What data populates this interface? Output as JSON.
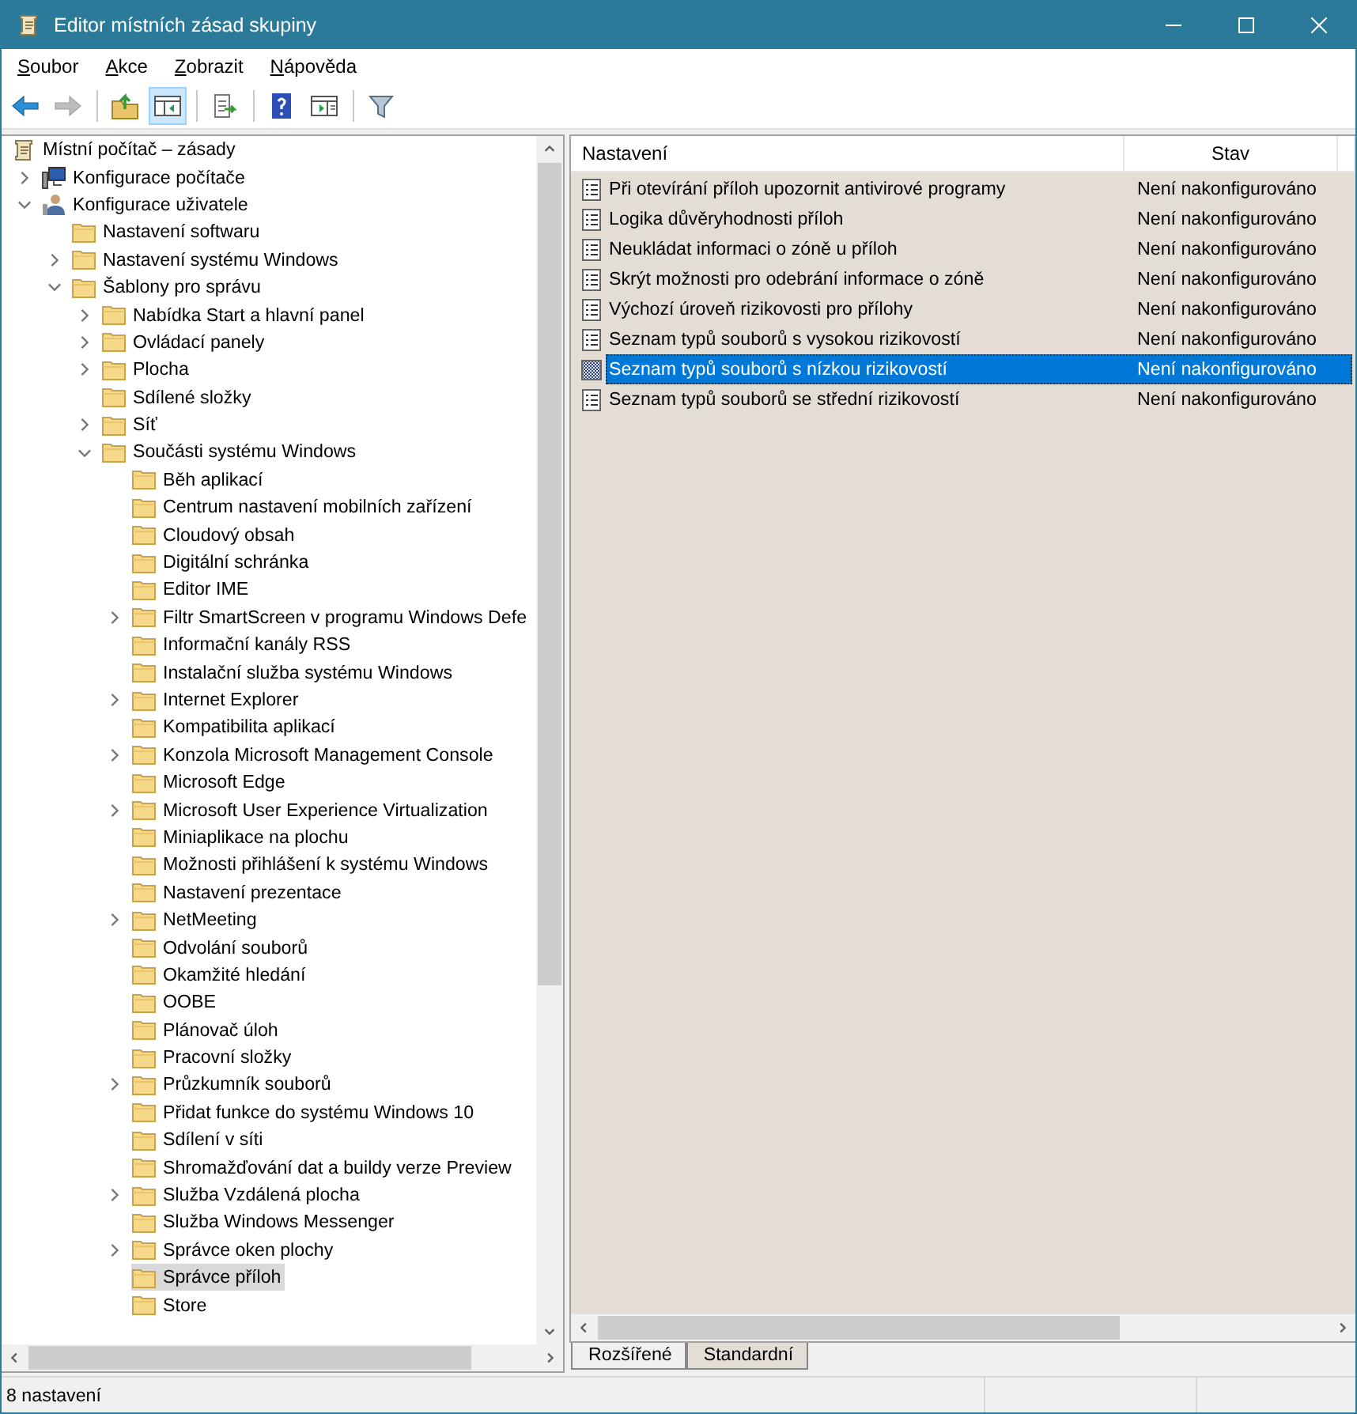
{
  "window": {
    "title": "Editor místních zásad skupiny"
  },
  "menu": [
    {
      "label": "Soubor"
    },
    {
      "label": "Akce"
    },
    {
      "label": "Zobrazit"
    },
    {
      "label": "Nápověda"
    }
  ],
  "toolbar": [
    {
      "pressed": false,
      "disabled": false
    },
    {
      "pressed": false,
      "disabled": true
    },
    {
      "pressed": false,
      "disabled": false
    },
    {
      "pressed": true,
      "disabled": false
    },
    {
      "pressed": false,
      "disabled": false
    },
    {
      "pressed": false,
      "disabled": false
    },
    {
      "pressed": false,
      "disabled": false
    },
    {
      "pressed": false,
      "disabled": false
    }
  ],
  "tree": {
    "label": "Místní počítač – zásady",
    "kind": "root",
    "selected": false,
    "children": [
      {
        "label": "Konfigurace počítače",
        "kind": "computer",
        "selected": false,
        "expanded": false
      },
      {
        "label": "Konfigurace uživatele",
        "kind": "user",
        "selected": false,
        "expanded": true,
        "children": [
          {
            "label": "Nastavení softwaru",
            "kind": "folder",
            "selected": false
          },
          {
            "label": "Nastavení systému Windows",
            "kind": "folder",
            "selected": false,
            "expanded": false
          },
          {
            "label": "Šablony pro správu",
            "kind": "folder",
            "selected": false,
            "expanded": true,
            "children": [
              {
                "label": "Nabídka Start a hlavní panel",
                "kind": "folder",
                "selected": false,
                "expanded": false
              },
              {
                "label": "Ovládací panely",
                "kind": "folder",
                "selected": false,
                "expanded": false
              },
              {
                "label": "Plocha",
                "kind": "folder",
                "selected": false,
                "expanded": false
              },
              {
                "label": "Sdílené složky",
                "kind": "folder",
                "selected": false
              },
              {
                "label": "Síť",
                "kind": "folder",
                "selected": false,
                "expanded": false
              },
              {
                "label": "Součásti systému Windows",
                "kind": "folder",
                "selected": false,
                "expanded": true,
                "children": [
                  {
                    "label": "Běh aplikací",
                    "kind": "folder",
                    "selected": false
                  },
                  {
                    "label": "Centrum nastavení mobilních zařízení",
                    "kind": "folder",
                    "selected": false
                  },
                  {
                    "label": "Cloudový obsah",
                    "kind": "folder",
                    "selected": false
                  },
                  {
                    "label": "Digitální schránka",
                    "kind": "folder",
                    "selected": false
                  },
                  {
                    "label": "Editor IME",
                    "kind": "folder",
                    "selected": false
                  },
                  {
                    "label": "Filtr SmartScreen v programu Windows Defe",
                    "kind": "folder",
                    "selected": false,
                    "expanded": false
                  },
                  {
                    "label": "Informační kanály RSS",
                    "kind": "folder",
                    "selected": false
                  },
                  {
                    "label": "Instalační služba systému Windows",
                    "kind": "folder",
                    "selected": false
                  },
                  {
                    "label": "Internet Explorer",
                    "kind": "folder",
                    "selected": false,
                    "expanded": false
                  },
                  {
                    "label": "Kompatibilita aplikací",
                    "kind": "folder",
                    "selected": false
                  },
                  {
                    "label": "Konzola Microsoft Management Console",
                    "kind": "folder",
                    "selected": false,
                    "expanded": false
                  },
                  {
                    "label": "Microsoft Edge",
                    "kind": "folder",
                    "selected": false
                  },
                  {
                    "label": "Microsoft User Experience Virtualization",
                    "kind": "folder",
                    "selected": false,
                    "expanded": false
                  },
                  {
                    "label": "Miniaplikace na plochu",
                    "kind": "folder",
                    "selected": false
                  },
                  {
                    "label": "Možnosti přihlášení k systému Windows",
                    "kind": "folder",
                    "selected": false
                  },
                  {
                    "label": "Nastavení prezentace",
                    "kind": "folder",
                    "selected": false
                  },
                  {
                    "label": "NetMeeting",
                    "kind": "folder",
                    "selected": false,
                    "expanded": false
                  },
                  {
                    "label": "Odvolání souborů",
                    "kind": "folder",
                    "selected": false
                  },
                  {
                    "label": "Okamžité hledání",
                    "kind": "folder",
                    "selected": false
                  },
                  {
                    "label": "OOBE",
                    "kind": "folder",
                    "selected": false
                  },
                  {
                    "label": "Plánovač úloh",
                    "kind": "folder",
                    "selected": false
                  },
                  {
                    "label": "Pracovní složky",
                    "kind": "folder",
                    "selected": false
                  },
                  {
                    "label": "Průzkumník souborů",
                    "kind": "folder",
                    "selected": false,
                    "expanded": false
                  },
                  {
                    "label": "Přidat funkce do systému Windows 10",
                    "kind": "folder",
                    "selected": false
                  },
                  {
                    "label": "Sdílení v síti",
                    "kind": "folder",
                    "selected": false
                  },
                  {
                    "label": "Shromažďování dat a buildy verze Preview",
                    "kind": "folder",
                    "selected": false
                  },
                  {
                    "label": "Služba Vzdálená plocha",
                    "kind": "folder",
                    "selected": false,
                    "expanded": false
                  },
                  {
                    "label": "Služba Windows Messenger",
                    "kind": "folder",
                    "selected": false
                  },
                  {
                    "label": "Správce oken plochy",
                    "kind": "folder",
                    "selected": false,
                    "expanded": false
                  },
                  {
                    "label": "Správce příloh",
                    "kind": "folder",
                    "selected": true
                  },
                  {
                    "label": "Store",
                    "kind": "folder",
                    "selected": false
                  }
                ]
              }
            ]
          }
        ]
      }
    ]
  },
  "table": {
    "columns": [
      "Nastavení",
      "Stav"
    ],
    "rows": [
      {
        "setting": "Při otevírání příloh upozornit antivirové programy",
        "state": "Není nakonfigurováno",
        "selected": false
      },
      {
        "setting": "Logika důvěryhodnosti příloh",
        "state": "Není nakonfigurováno",
        "selected": false
      },
      {
        "setting": "Neukládat informaci o zóně u příloh",
        "state": "Není nakonfigurováno",
        "selected": false
      },
      {
        "setting": "Skrýt možnosti pro odebrání informace o zóně",
        "state": "Není nakonfigurováno",
        "selected": false
      },
      {
        "setting": "Výchozí úroveň rizikovosti pro přílohy",
        "state": "Není nakonfigurováno",
        "selected": false
      },
      {
        "setting": "Seznam typů souborů s vysokou rizikovostí",
        "state": "Není nakonfigurováno",
        "selected": false
      },
      {
        "setting": "Seznam typů souborů s nízkou rizikovostí",
        "state": "Není nakonfigurováno",
        "selected": true
      },
      {
        "setting": "Seznam typů souborů se střední rizikovostí",
        "state": "Není nakonfigurováno",
        "selected": false
      }
    ]
  },
  "tabs": [
    {
      "label": "Rozšířené",
      "selected": false
    },
    {
      "label": "Standardní",
      "selected": true
    }
  ],
  "status_bar": "8 nastavení"
}
